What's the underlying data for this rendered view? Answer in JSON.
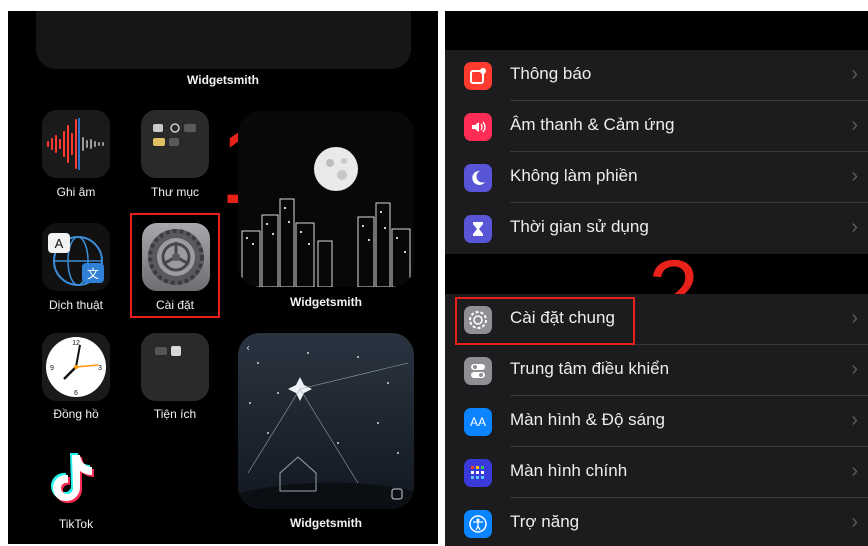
{
  "home": {
    "top_widget_label": "Widgetsmith",
    "apps": [
      {
        "name": "Ghi âm"
      },
      {
        "name": "Thư mục"
      },
      {
        "name": "Dịch thuật"
      },
      {
        "name": "Cài đặt"
      },
      {
        "name": "Đồng hồ"
      },
      {
        "name": "Tiện ích"
      },
      {
        "name": "TikTok"
      }
    ],
    "widget_city_label": "Widgetsmith",
    "widget_night_label": "Widgetsmith",
    "step_number": "1"
  },
  "settings": {
    "group1": [
      {
        "label": "Thông báo",
        "icon": "notifications-icon",
        "color": "#ff3b30"
      },
      {
        "label": "Âm thanh & Cảm ứng",
        "icon": "sound-icon",
        "color": "#ff2d55"
      },
      {
        "label": "Không làm phiền",
        "icon": "moon-icon",
        "color": "#5856d6"
      },
      {
        "label": "Thời gian sử dụng",
        "icon": "hourglass-icon",
        "color": "#5856d6"
      }
    ],
    "group2": [
      {
        "label": "Cài đặt chung",
        "icon": "gear-icon",
        "color": "#8e8e93"
      },
      {
        "label": "Trung tâm điều khiển",
        "icon": "toggles-icon",
        "color": "#8e8e93"
      },
      {
        "label": "Màn hình & Độ sáng",
        "icon": "display-icon",
        "color": "#0a84ff",
        "icon_text": "AA"
      },
      {
        "label": "Màn hình chính",
        "icon": "home-screen-icon",
        "color": "#3a3adb"
      },
      {
        "label": "Trợ năng",
        "icon": "accessibility-icon",
        "color": "#0a84ff"
      }
    ],
    "step_number": "2",
    "chevron": "›"
  },
  "colors": {
    "highlight": "#e8211b",
    "row_bg": "#1c1c1e"
  }
}
